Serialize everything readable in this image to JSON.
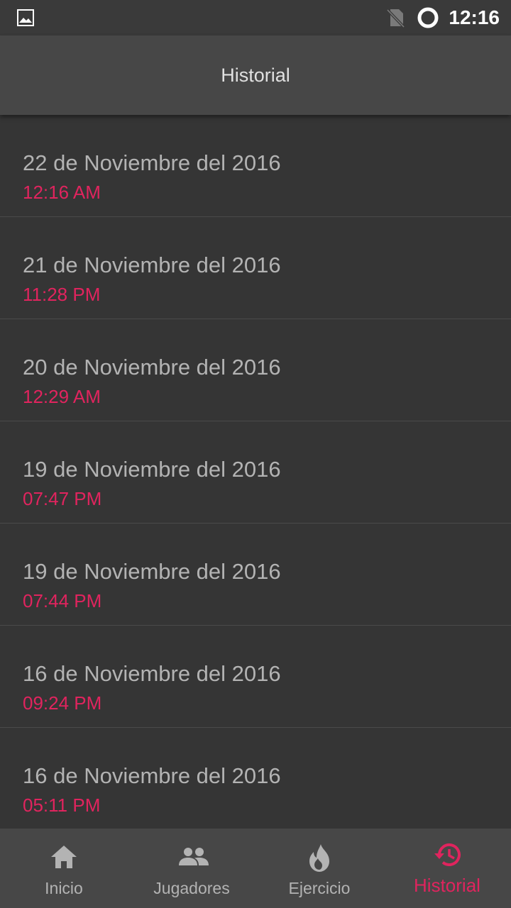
{
  "status_bar": {
    "time": "12:16",
    "icons": [
      "gallery-icon",
      "no-sim-icon",
      "sync-ring-icon"
    ]
  },
  "header": {
    "title": "Historial"
  },
  "history": [
    {
      "date": "22 de Noviembre del 2016",
      "time": "12:16 AM"
    },
    {
      "date": "21 de Noviembre del 2016",
      "time": "11:28 PM"
    },
    {
      "date": "20 de Noviembre del 2016",
      "time": "12:29 AM"
    },
    {
      "date": "19 de Noviembre del 2016",
      "time": "07:47 PM"
    },
    {
      "date": "19 de Noviembre del 2016",
      "time": "07:44 PM"
    },
    {
      "date": "16 de Noviembre del 2016",
      "time": "09:24 PM"
    },
    {
      "date": "16 de Noviembre del 2016",
      "time": "05:11 PM"
    }
  ],
  "bottom_nav": [
    {
      "label": "Inicio",
      "icon": "home-icon"
    },
    {
      "label": "Jugadores",
      "icon": "people-icon"
    },
    {
      "label": "Ejercicio",
      "icon": "flame-icon"
    },
    {
      "label": "Historial",
      "icon": "history-icon",
      "active": true
    }
  ],
  "colors": {
    "background": "#353535",
    "app_bar": "#474747",
    "accent": "#e0245e",
    "text_secondary": "#b3b3b3"
  }
}
